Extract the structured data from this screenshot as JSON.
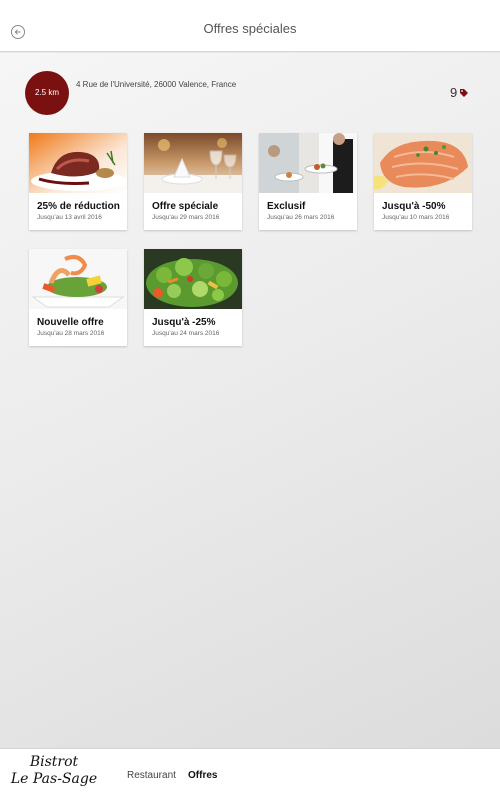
{
  "header": {
    "title": "Offres spéciales",
    "back_icon": "back-arrow-icon"
  },
  "location": {
    "distance": "2.5 km",
    "address": "4 Rue de l'Université, 26000 Valence, France"
  },
  "offers_count": "9",
  "offers": [
    {
      "title": "25% de réduction",
      "date": "Jusqu'au 13 avril 2016"
    },
    {
      "title": "Offre spéciale",
      "date": "Jusqu'au 29 mars 2016"
    },
    {
      "title": "Exclusif",
      "date": "Jusqu'au 26 mars 2016"
    },
    {
      "title": "Jusqu'à -50%",
      "date": "Jusqu'au 10 mars 2016"
    },
    {
      "title": "Nouvelle offre",
      "date": "Jusqu'au 28 mars 2016"
    },
    {
      "title": "Jusqu'à -25%",
      "date": "Jusqu'au 24 mars 2016"
    }
  ],
  "footer": {
    "logo_line1": "Bistrot",
    "logo_line2": "Le Pas-Sage",
    "tabs": [
      {
        "label": "Restaurant"
      },
      {
        "label": "Offres"
      }
    ]
  },
  "colors": {
    "accent": "#7a1010",
    "topbar": "#ffffff",
    "background": "#ececec"
  }
}
